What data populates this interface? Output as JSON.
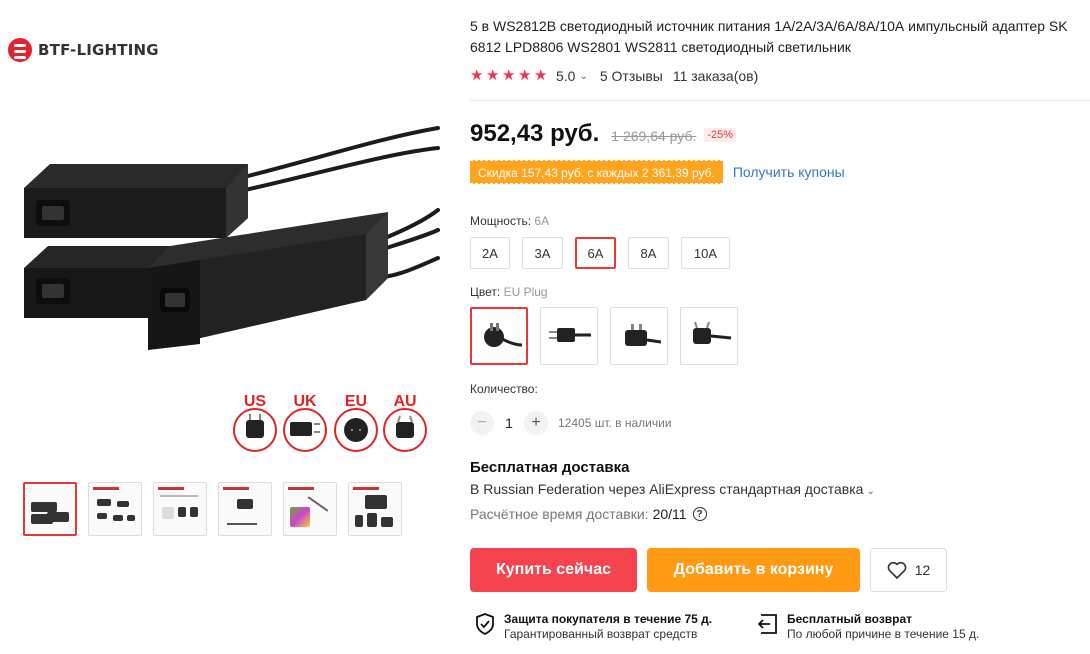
{
  "brand": {
    "name": "BTF-LIGHTING"
  },
  "gallery": {
    "plug_labels": [
      "US",
      "UK",
      "EU",
      "AU"
    ],
    "thumbnail_count": 6,
    "active_thumbnail": 0
  },
  "product": {
    "title_line1": "5 в WS2812B светодиодный источник питания 1А/2А/3А/6А/8А/10А импульсный адаптер SK",
    "title_line2": "6812 LPD8806 WS2801 WS2811 светодиодный светильник",
    "rating": "5.0",
    "reviews": "5 Отзывы",
    "orders": "11 заказа(ов)",
    "stars": 5
  },
  "pricing": {
    "price": "952,43 руб.",
    "old_price": "1 269,64 руб.",
    "discount": "-25%",
    "coupon": "Скидка 157,43 руб. с каждых 2 361,39 руб.",
    "get_coupons": "Получить купоны"
  },
  "options": {
    "power_label": "Мощность:",
    "power_selected": "6A",
    "power_values": [
      "2A",
      "3A",
      "6A",
      "8A",
      "10A"
    ],
    "color_label": "Цвет:",
    "color_selected": "EU Plug",
    "quantity_label": "Количество:",
    "quantity": "1",
    "stock": "12405 шт. в наличии"
  },
  "shipping": {
    "title": "Бесплатная доставка",
    "line": "В Russian Federation через AliExpress стандартная доставка",
    "eta_label": "Расчётное время доставки:",
    "eta_date": "20/11"
  },
  "actions": {
    "buy_now": "Купить сейчас",
    "add_to_cart": "Добавить в корзину",
    "wishlist_count": "12"
  },
  "guarantees": {
    "protection_title": "Защита покупателя в течение 75 д.",
    "protection_sub": "Гарантированный возврат средств",
    "return_title": "Бесплатный возврат",
    "return_sub": "По любой причине в течение 15 д."
  },
  "colors": {
    "accent_red": "#f5444f",
    "cart_orange": "#ff9a12",
    "coupon_orange": "#ffa41c",
    "star_red": "#f5354a",
    "link_blue": "#2e7bc4"
  }
}
